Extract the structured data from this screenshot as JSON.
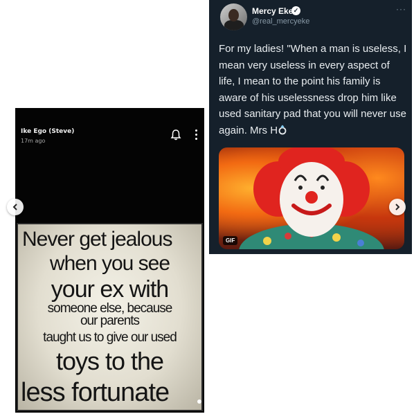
{
  "story": {
    "user_name": "Ike Ego (Steve)",
    "time_ago": "17m ago",
    "icons": [
      "bell-icon",
      "more-vertical-icon"
    ],
    "meme_lines": [
      "Never get jealous",
      "when you see",
      "your ex with",
      "someone else, because",
      "our parents",
      "taught us to give our used",
      "toys to the",
      "less fortunate"
    ]
  },
  "tweet": {
    "name": "Mercy Eke",
    "handle": "@real_mercyeke",
    "more": "···",
    "text": "For my ladies! \"When a man is useless, I mean very useless in every aspect of life, I mean to the point his family is aware of his uselessness drop him like used sanitary pad that you will never use again. Mrs H",
    "trailing_emoji": "ring-icon",
    "media_badge": "GIF",
    "background": "#15202b"
  },
  "carousel": {
    "prev_icon": "chevron-left-icon",
    "next_icon": "chevron-right-icon"
  }
}
